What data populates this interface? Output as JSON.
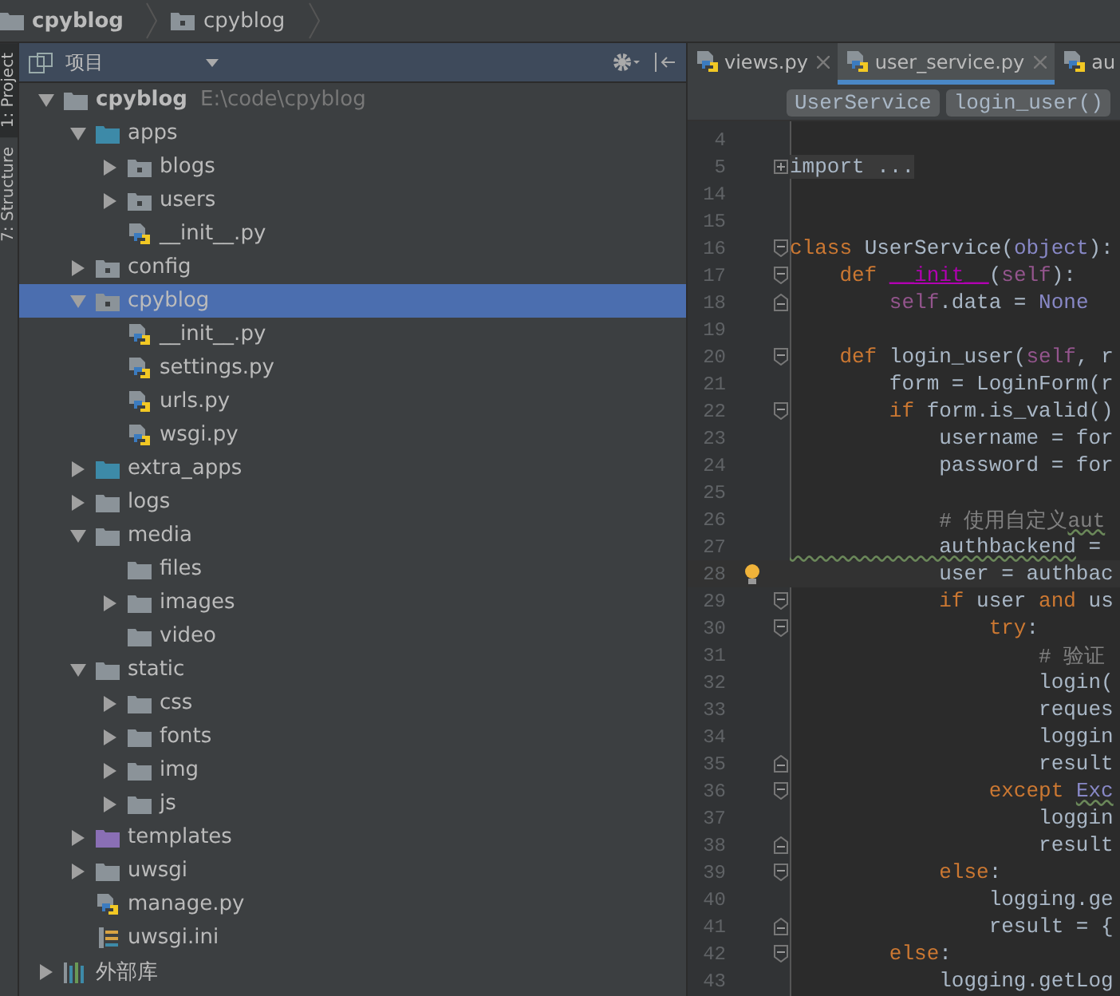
{
  "breadcrumb": [
    {
      "label": "cpyblog",
      "kind": "folder",
      "bold": true
    },
    {
      "label": "cpyblog",
      "kind": "package",
      "bold": false
    }
  ],
  "side_tabs": [
    {
      "label": "1: Project",
      "selected": true
    },
    {
      "label": "7: Structure",
      "selected": false
    }
  ],
  "project_panel": {
    "title": "项目",
    "tree": [
      {
        "name": "cpyblog",
        "kind": "folder",
        "path": "E:\\code\\cpyblog",
        "bold": true,
        "expanded": true,
        "selected": false,
        "children": [
          {
            "name": "apps",
            "kind": "source",
            "expanded": true,
            "selected": false,
            "children": [
              {
                "name": "blogs",
                "kind": "package",
                "expanded": false,
                "selected": false
              },
              {
                "name": "users",
                "kind": "package",
                "expanded": false,
                "selected": false
              },
              {
                "name": "__init__.py",
                "kind": "python",
                "selected": false
              }
            ]
          },
          {
            "name": "config",
            "kind": "package",
            "expanded": false,
            "selected": false
          },
          {
            "name": "cpyblog",
            "kind": "package",
            "expanded": true,
            "selected": true,
            "children": [
              {
                "name": "__init__.py",
                "kind": "python",
                "selected": false
              },
              {
                "name": "settings.py",
                "kind": "python",
                "selected": false
              },
              {
                "name": "urls.py",
                "kind": "python",
                "selected": false
              },
              {
                "name": "wsgi.py",
                "kind": "python",
                "selected": false
              }
            ]
          },
          {
            "name": "extra_apps",
            "kind": "source",
            "expanded": false,
            "selected": false
          },
          {
            "name": "logs",
            "kind": "folder",
            "expanded": false,
            "selected": false
          },
          {
            "name": "media",
            "kind": "folder",
            "expanded": true,
            "selected": false,
            "children": [
              {
                "name": "files",
                "kind": "folder",
                "selected": false
              },
              {
                "name": "images",
                "kind": "folder",
                "expanded": false,
                "selected": false
              },
              {
                "name": "video",
                "kind": "folder",
                "selected": false
              }
            ]
          },
          {
            "name": "static",
            "kind": "folder",
            "expanded": true,
            "selected": false,
            "children": [
              {
                "name": "css",
                "kind": "folder",
                "expanded": false,
                "selected": false
              },
              {
                "name": "fonts",
                "kind": "folder",
                "expanded": false,
                "selected": false
              },
              {
                "name": "img",
                "kind": "folder",
                "expanded": false,
                "selected": false
              },
              {
                "name": "js",
                "kind": "folder",
                "expanded": false,
                "selected": false
              }
            ]
          },
          {
            "name": "templates",
            "kind": "templates",
            "expanded": false,
            "selected": false
          },
          {
            "name": "uwsgi",
            "kind": "folder",
            "expanded": false,
            "selected": false
          },
          {
            "name": "manage.py",
            "kind": "python",
            "selected": false
          },
          {
            "name": "uwsgi.ini",
            "kind": "ini",
            "selected": false
          }
        ]
      },
      {
        "name": "外部库",
        "kind": "library",
        "expanded": false,
        "selected": false
      }
    ]
  },
  "editor": {
    "tabs": [
      {
        "label": "views.py",
        "selected": false,
        "closable": true
      },
      {
        "label": "user_service.py",
        "selected": true,
        "closable": true
      },
      {
        "label": "au",
        "selected": false,
        "closable": false
      }
    ],
    "crumbs": [
      "UserService",
      "login_user()"
    ],
    "lines": [
      {
        "no": "4",
        "kind": "plain"
      },
      {
        "no": "5",
        "kind": "fold-plus",
        "tokens": [
          {
            "kind": "folded",
            "text": "import ..."
          }
        ]
      },
      {
        "no": "14",
        "kind": "plain"
      },
      {
        "no": "15",
        "kind": "plain"
      },
      {
        "no": "16",
        "kind": "fold-start",
        "tokens": [
          {
            "kind": "keyword",
            "text": "class "
          },
          {
            "kind": "plain",
            "text": "UserService("
          },
          {
            "kind": "builtin",
            "text": "object"
          },
          {
            "kind": "plain",
            "text": "):"
          }
        ]
      },
      {
        "no": "17",
        "kind": "fold-start",
        "tokens": [
          {
            "kind": "keyword",
            "text": "    def "
          },
          {
            "kind": "magic",
            "text": "__init__"
          },
          {
            "kind": "plain",
            "text": "("
          },
          {
            "kind": "self",
            "text": "self"
          },
          {
            "kind": "plain",
            "text": "):"
          }
        ]
      },
      {
        "no": "18",
        "kind": "fold-end",
        "tokens": [
          {
            "kind": "self",
            "text": "        self"
          },
          {
            "kind": "plain",
            "text": ".data = "
          },
          {
            "kind": "builtin",
            "text": "None"
          }
        ]
      },
      {
        "no": "19",
        "kind": "plain"
      },
      {
        "no": "20",
        "kind": "fold-start",
        "tokens": [
          {
            "kind": "keyword",
            "text": "    def "
          },
          {
            "kind": "plain",
            "text": "login_user("
          },
          {
            "kind": "self",
            "text": "self"
          },
          {
            "kind": "plain",
            "text": ", r"
          }
        ]
      },
      {
        "no": "21",
        "kind": "plain",
        "tokens": [
          {
            "kind": "plain",
            "text": "        form = LoginForm(r"
          }
        ]
      },
      {
        "no": "22",
        "kind": "fold-start",
        "tokens": [
          {
            "kind": "keyword",
            "text": "        if "
          },
          {
            "kind": "plain",
            "text": "form.is_valid()"
          }
        ]
      },
      {
        "no": "23",
        "kind": "plain",
        "tokens": [
          {
            "kind": "plain",
            "text": "            username = for"
          }
        ]
      },
      {
        "no": "24",
        "kind": "plain",
        "tokens": [
          {
            "kind": "plain",
            "text": "            password = for"
          }
        ]
      },
      {
        "no": "25",
        "kind": "plain"
      },
      {
        "no": "26",
        "kind": "plain",
        "tokens": [
          {
            "kind": "comment",
            "text": "            # 使用自定义"
          },
          {
            "kind": "comment",
            "text": "aut",
            "warn": true
          }
        ]
      },
      {
        "no": "27",
        "kind": "plain",
        "tokens": [
          {
            "kind": "plain",
            "text": "            authbackend",
            "warn": true
          },
          {
            "kind": "plain",
            "text": " ="
          }
        ]
      },
      {
        "no": "28",
        "kind": "plain",
        "current": true,
        "tokens": [
          {
            "kind": "plain",
            "text": "            user = authbac"
          }
        ]
      },
      {
        "no": "29",
        "kind": "fold-start",
        "tokens": [
          {
            "kind": "keyword",
            "text": "            if "
          },
          {
            "kind": "plain",
            "text": "user "
          },
          {
            "kind": "keyword",
            "text": "and "
          },
          {
            "kind": "plain",
            "text": "us"
          }
        ]
      },
      {
        "no": "30",
        "kind": "fold-start",
        "tokens": [
          {
            "kind": "keyword",
            "text": "                try"
          },
          {
            "kind": "plain",
            "text": ":"
          }
        ]
      },
      {
        "no": "31",
        "kind": "plain",
        "tokens": [
          {
            "kind": "comment",
            "text": "                    # 验证"
          }
        ]
      },
      {
        "no": "32",
        "kind": "plain",
        "tokens": [
          {
            "kind": "plain",
            "text": "                    login("
          }
        ]
      },
      {
        "no": "33",
        "kind": "plain",
        "tokens": [
          {
            "kind": "plain",
            "text": "                    reques"
          }
        ]
      },
      {
        "no": "34",
        "kind": "plain",
        "tokens": [
          {
            "kind": "plain",
            "text": "                    loggin"
          }
        ]
      },
      {
        "no": "35",
        "kind": "fold-end",
        "tokens": [
          {
            "kind": "plain",
            "text": "                    result"
          }
        ]
      },
      {
        "no": "36",
        "kind": "fold-start",
        "tokens": [
          {
            "kind": "keyword",
            "text": "                except "
          },
          {
            "kind": "builtin",
            "text": "Exc",
            "warn": true
          }
        ]
      },
      {
        "no": "37",
        "kind": "plain",
        "tokens": [
          {
            "kind": "plain",
            "text": "                    loggin"
          }
        ]
      },
      {
        "no": "38",
        "kind": "fold-end",
        "tokens": [
          {
            "kind": "plain",
            "text": "                    result"
          }
        ]
      },
      {
        "no": "39",
        "kind": "fold-start",
        "tokens": [
          {
            "kind": "keyword",
            "text": "            else"
          },
          {
            "kind": "plain",
            "text": ":"
          }
        ]
      },
      {
        "no": "40",
        "kind": "plain",
        "tokens": [
          {
            "kind": "plain",
            "text": "                logging.ge"
          }
        ]
      },
      {
        "no": "41",
        "kind": "fold-end",
        "tokens": [
          {
            "kind": "plain",
            "text": "                result = {"
          }
        ]
      },
      {
        "no": "42",
        "kind": "fold-start",
        "tokens": [
          {
            "kind": "keyword",
            "text": "        else"
          },
          {
            "kind": "plain",
            "text": ":"
          }
        ]
      },
      {
        "no": "43",
        "kind": "plain",
        "tokens": [
          {
            "kind": "plain",
            "text": "            logging.getLog"
          }
        ]
      }
    ]
  }
}
